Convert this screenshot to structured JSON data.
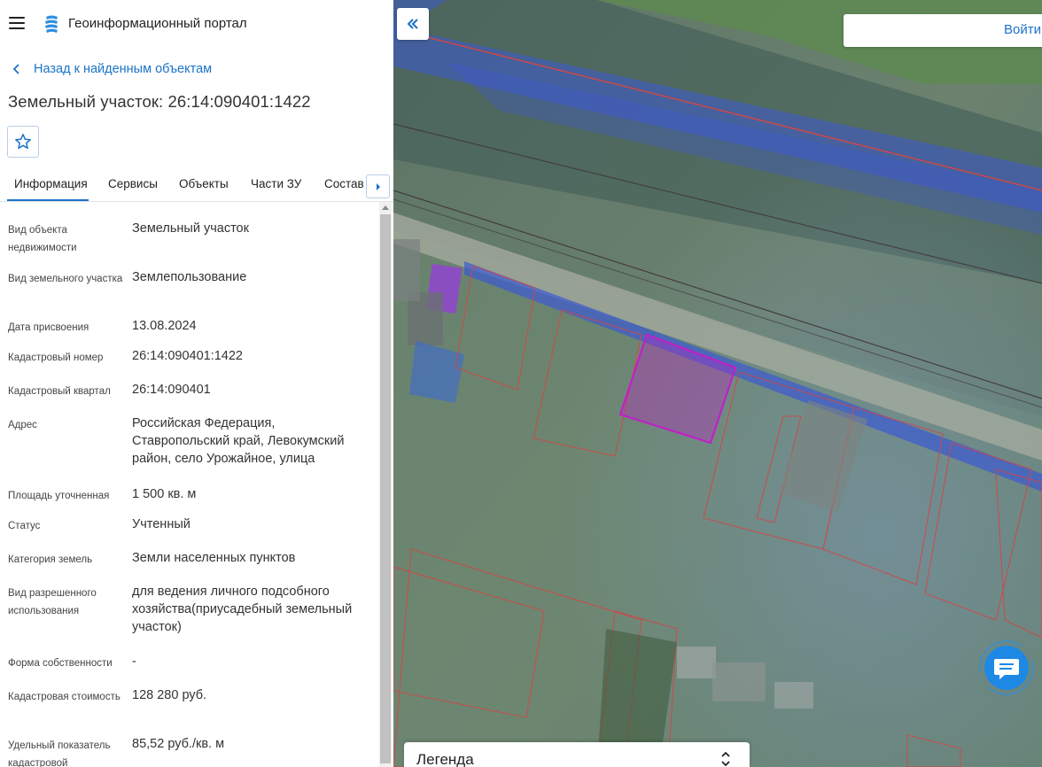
{
  "header": {
    "portal_title": "Геоинформационный портал"
  },
  "navigation": {
    "back_label": "Назад к найденным объектам"
  },
  "page_title": "Земельный участок: 26:14:090401:1422",
  "tabs": [
    {
      "label": "Информация",
      "active": true
    },
    {
      "label": "Сервисы"
    },
    {
      "label": "Объекты"
    },
    {
      "label": "Части ЗУ"
    },
    {
      "label": "Состав"
    }
  ],
  "info": [
    {
      "label": "Вид объекта недвижимости",
      "value": "Земельный участок"
    },
    {
      "label": "Вид земельного участка",
      "value": "Землепользование"
    },
    {
      "label": "Дата присвоения",
      "value": "13.08.2024"
    },
    {
      "label": "Кадастровый номер",
      "value": "26:14:090401:1422"
    },
    {
      "label": "Кадастровый квартал",
      "value": "26:14:090401"
    },
    {
      "label": "Адрес",
      "value": "Российская Федерация, Ставропольский край, Левокумский район, село Урожайное, улица"
    },
    {
      "label": "Площадь уточненная",
      "value": "1 500 кв. м"
    },
    {
      "label": "Статус",
      "value": "Учтенный"
    },
    {
      "label": "Категория земель",
      "value": "Земли населенных пунктов"
    },
    {
      "label": "Вид разрешенного использования",
      "value": "для ведения личного подсобного хозяйства(приусадебный земельный участок)"
    },
    {
      "label": "Форма собственности",
      "value": "-"
    },
    {
      "label": "Кадастровая стоимость",
      "value": "128 280 руб."
    },
    {
      "label": "Удельный показатель кадастровой",
      "value": "85,52 руб./кв. м"
    }
  ],
  "map": {
    "search": {
      "placeholder": "",
      "login_label": "Войти"
    },
    "legend_label": "Легенда"
  },
  "icons": {
    "menu": "hamburger-icon",
    "logo": "portal-logo-icon",
    "back": "chevron-left-icon",
    "favorite": "star-outline-icon",
    "tabs_scroll": "caret-right-icon",
    "collapse": "double-chevron-left-icon",
    "legend_toggle": "chevron-up-down-icon",
    "chat": "chat-bubble-icon"
  },
  "colors": {
    "accent": "#1a73c8",
    "selected_parcel": "#c020c8",
    "parcel_border": "#d24646",
    "zone_fill": "#3c5ad2"
  }
}
